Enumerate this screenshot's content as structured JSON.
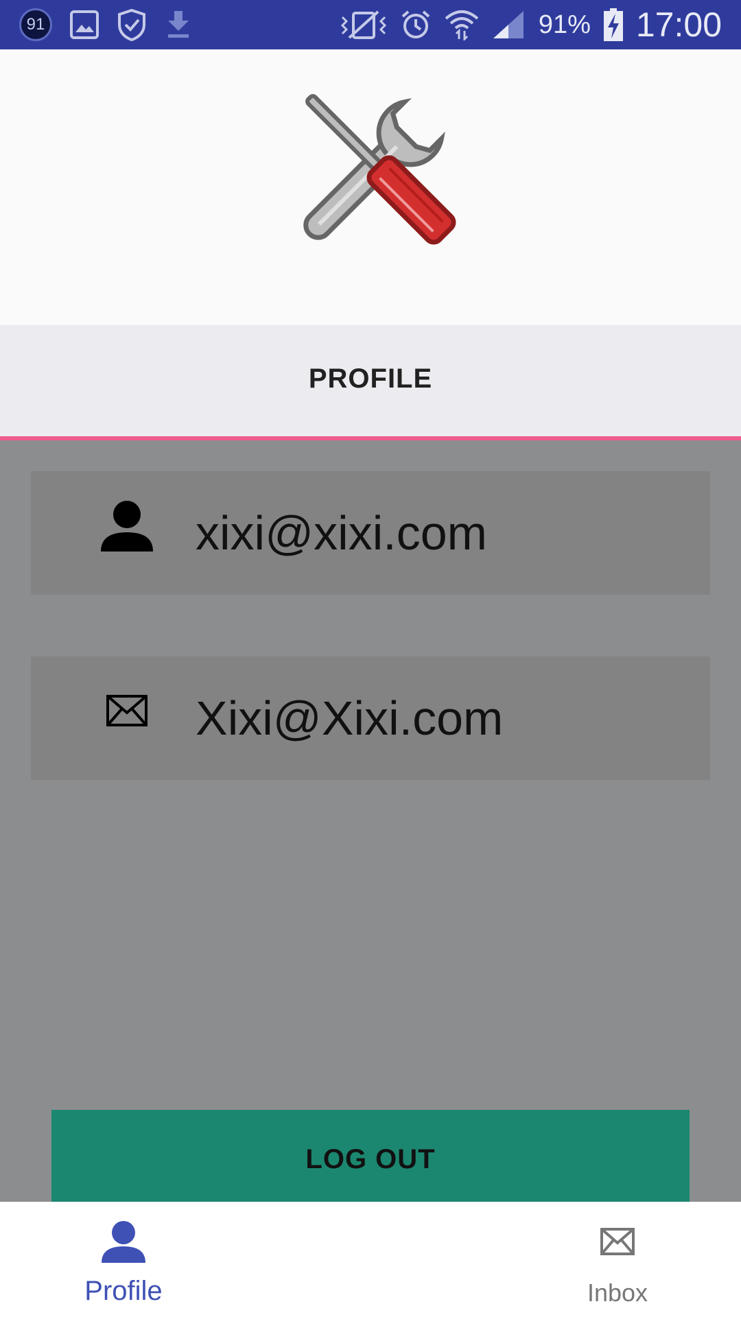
{
  "status_bar": {
    "badge_count": "91",
    "battery": "91%",
    "time": "17:00",
    "icons": [
      "notification-count-icon",
      "image-icon",
      "shield-check-icon",
      "download-icon",
      "vibrate-icon",
      "alarm-icon",
      "wifi-icon",
      "signal-icon",
      "battery-charging-icon"
    ]
  },
  "header": {
    "logo_icon": "tools-wrench-screwdriver-icon"
  },
  "tabs": {
    "active_label": "PROFILE",
    "indicator_color": "#ef5b8c"
  },
  "profile": {
    "username": "xixi@xixi.com",
    "email": "Xixi@Xixi.com"
  },
  "actions": {
    "logout_label": "LOG OUT",
    "logout_color": "#1c8770"
  },
  "bottom_nav": {
    "items": [
      {
        "label": "Profile",
        "icon": "person-icon",
        "active": true
      },
      {
        "label": "Inbox",
        "icon": "envelope-icon",
        "active": false
      }
    ],
    "active_color": "#3f51b5"
  }
}
